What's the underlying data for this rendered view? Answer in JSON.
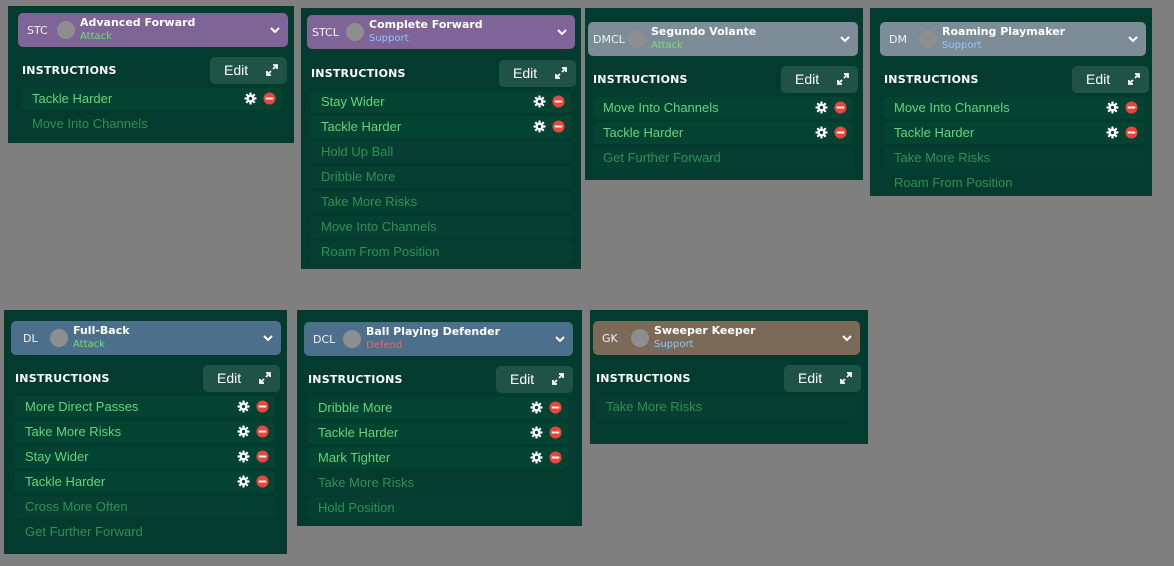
{
  "colors": {
    "background": "#7f7f7f",
    "panel": "#033c2e",
    "active_text": "#62d67a",
    "available_text": "#2f8f57",
    "attack": "#72df6f",
    "support": "#8fc7ff",
    "defend": "#ff5d5d",
    "remove": "#e8473f"
  },
  "common": {
    "instructions_label": "INSTRUCTIONS",
    "edit_label": "Edit"
  },
  "panels": [
    {
      "position": "STC",
      "role": "Advanced Forward",
      "duty": "Attack",
      "instructions": [
        {
          "label": "Tackle Harder",
          "active": true
        },
        {
          "label": "Move Into Channels",
          "active": false
        }
      ]
    },
    {
      "position": "STCL",
      "role": "Complete Forward",
      "duty": "Support",
      "instructions": [
        {
          "label": "Stay Wider",
          "active": true
        },
        {
          "label": "Tackle Harder",
          "active": true
        },
        {
          "label": "Hold Up Ball",
          "active": false
        },
        {
          "label": "Dribble More",
          "active": false
        },
        {
          "label": "Take More Risks",
          "active": false
        },
        {
          "label": "Move Into Channels",
          "active": false
        },
        {
          "label": "Roam From Position",
          "active": false
        }
      ]
    },
    {
      "position": "DMCL",
      "role": "Segundo Volante",
      "duty": "Attack",
      "instructions": [
        {
          "label": "Move Into Channels",
          "active": true
        },
        {
          "label": "Tackle Harder",
          "active": true
        },
        {
          "label": "Get Further Forward",
          "active": false
        }
      ]
    },
    {
      "position": "DM",
      "role": "Roaming Playmaker",
      "duty": "Support",
      "instructions": [
        {
          "label": "Move Into Channels",
          "active": true
        },
        {
          "label": "Tackle Harder",
          "active": true
        },
        {
          "label": "Take More Risks",
          "active": false
        },
        {
          "label": "Roam From Position",
          "active": false
        }
      ]
    },
    {
      "position": "DL",
      "role": "Full-Back",
      "duty": "Attack",
      "instructions": [
        {
          "label": "More Direct Passes",
          "active": true
        },
        {
          "label": "Take More Risks",
          "active": true
        },
        {
          "label": "Stay Wider",
          "active": true
        },
        {
          "label": "Tackle Harder",
          "active": true
        },
        {
          "label": "Cross More Often",
          "active": false
        },
        {
          "label": "Get Further Forward",
          "active": false
        }
      ]
    },
    {
      "position": "DCL",
      "role": "Ball Playing Defender",
      "duty": "Defend",
      "instructions": [
        {
          "label": "Dribble More",
          "active": true
        },
        {
          "label": "Tackle Harder",
          "active": true
        },
        {
          "label": "Mark Tighter",
          "active": true
        },
        {
          "label": "Take More Risks",
          "active": false
        },
        {
          "label": "Hold Position",
          "active": false
        }
      ]
    },
    {
      "position": "GK",
      "role": "Sweeper Keeper",
      "duty": "Support",
      "instructions": [
        {
          "label": "Take More Risks",
          "active": false
        }
      ]
    }
  ]
}
